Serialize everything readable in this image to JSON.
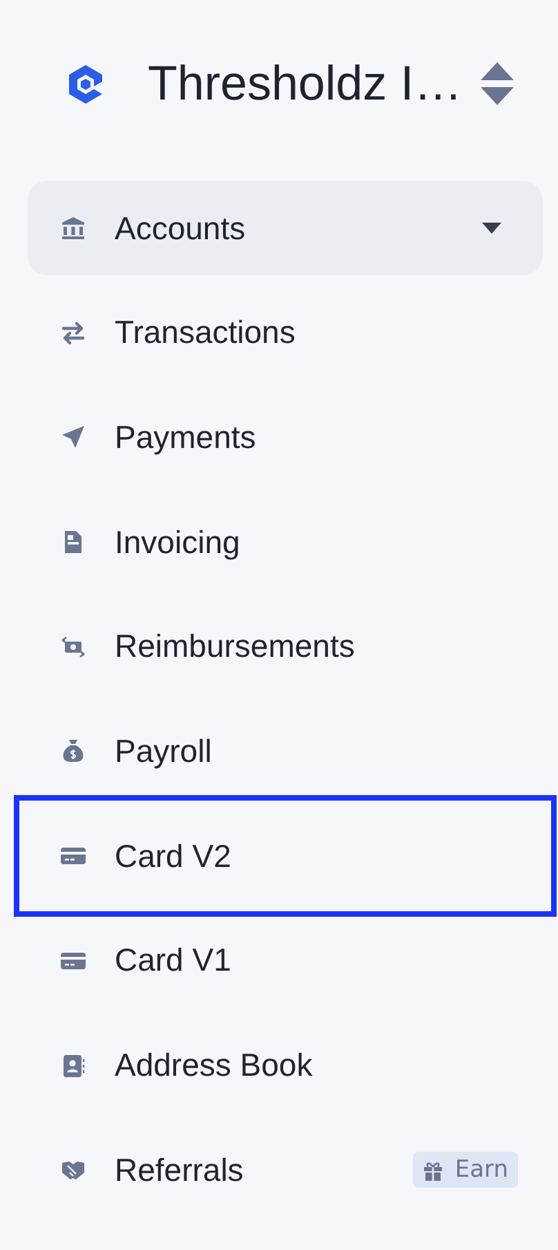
{
  "workspace": {
    "title": "Thresholdz I…"
  },
  "nav": {
    "items": [
      {
        "label": "Accounts",
        "selected": true,
        "focused": false,
        "has_submenu": true
      },
      {
        "label": "Transactions",
        "selected": false,
        "focused": false,
        "has_submenu": false
      },
      {
        "label": "Payments",
        "selected": false,
        "focused": false,
        "has_submenu": false
      },
      {
        "label": "Invoicing",
        "selected": false,
        "focused": false,
        "has_submenu": false
      },
      {
        "label": "Reimbursements",
        "selected": false,
        "focused": false,
        "has_submenu": false
      },
      {
        "label": "Payroll",
        "selected": false,
        "focused": false,
        "has_submenu": false
      },
      {
        "label": "Card V2",
        "selected": false,
        "focused": true,
        "has_submenu": false
      },
      {
        "label": "Card V1",
        "selected": false,
        "focused": false,
        "has_submenu": false
      },
      {
        "label": "Address Book",
        "selected": false,
        "focused": false,
        "has_submenu": false
      },
      {
        "label": "Referrals",
        "selected": false,
        "focused": false,
        "has_submenu": false,
        "badge": "Earn"
      }
    ]
  }
}
